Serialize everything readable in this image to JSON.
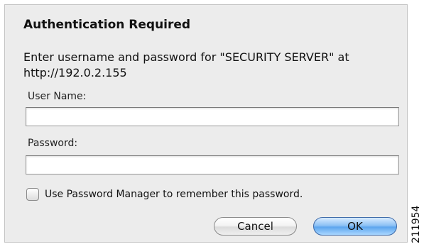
{
  "dialog": {
    "title": "Authentication Required",
    "message": "Enter username and password for \"SECURITY SERVER\" at http://192.0.2.155",
    "username_label": "User Name:",
    "username_value": "",
    "password_label": "Password:",
    "password_value": "",
    "remember_label": "Use Password Manager to remember this password.",
    "remember_checked": false,
    "cancel_label": "Cancel",
    "ok_label": "OK"
  },
  "figure_number": "211954",
  "colors": {
    "dialog_background": "#ececec",
    "ok_button_blue": "#5ea6ee"
  }
}
